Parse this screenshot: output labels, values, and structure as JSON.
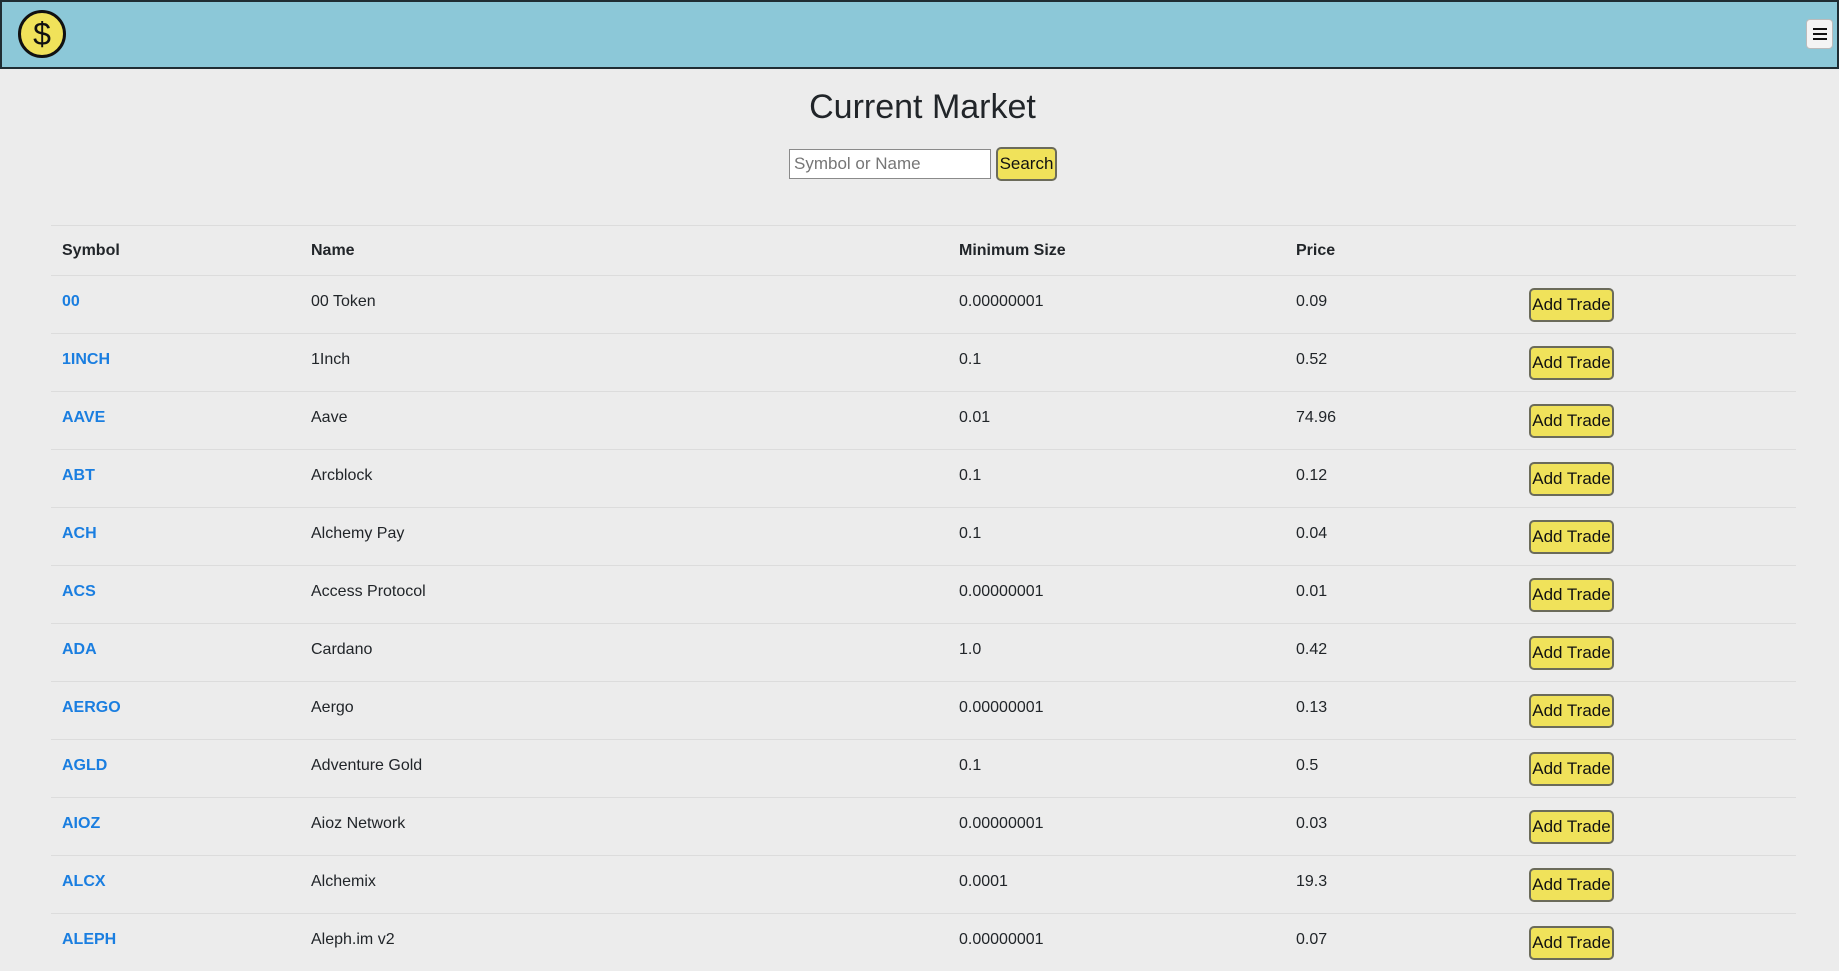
{
  "navbar": {
    "logo_icon": "dollar-coin-icon",
    "menu_icon": "hamburger-menu-icon",
    "brand_color": "#8cc8d8",
    "accent_color": "#f0e25a"
  },
  "page": {
    "title": "Current Market"
  },
  "search": {
    "placeholder": "Symbol or Name",
    "value": "",
    "button_label": "Search"
  },
  "table": {
    "headers": {
      "symbol": "Symbol",
      "name": "Name",
      "min_size": "Minimum Size",
      "price": "Price"
    },
    "action_label": "Add Trade",
    "rows": [
      {
        "symbol": "00",
        "name": "00 Token",
        "min_size": "0.00000001",
        "price": "0.09"
      },
      {
        "symbol": "1INCH",
        "name": "1Inch",
        "min_size": "0.1",
        "price": "0.52"
      },
      {
        "symbol": "AAVE",
        "name": "Aave",
        "min_size": "0.01",
        "price": "74.96"
      },
      {
        "symbol": "ABT",
        "name": "Arcblock",
        "min_size": "0.1",
        "price": "0.12"
      },
      {
        "symbol": "ACH",
        "name": "Alchemy Pay",
        "min_size": "0.1",
        "price": "0.04"
      },
      {
        "symbol": "ACS",
        "name": "Access Protocol",
        "min_size": "0.00000001",
        "price": "0.01"
      },
      {
        "symbol": "ADA",
        "name": "Cardano",
        "min_size": "1.0",
        "price": "0.42"
      },
      {
        "symbol": "AERGO",
        "name": "Aergo",
        "min_size": "0.00000001",
        "price": "0.13"
      },
      {
        "symbol": "AGLD",
        "name": "Adventure Gold",
        "min_size": "0.1",
        "price": "0.5"
      },
      {
        "symbol": "AIOZ",
        "name": "Aioz Network",
        "min_size": "0.00000001",
        "price": "0.03"
      },
      {
        "symbol": "ALCX",
        "name": "Alchemix",
        "min_size": "0.0001",
        "price": "19.3"
      },
      {
        "symbol": "ALEPH",
        "name": "Aleph.im v2",
        "min_size": "0.00000001",
        "price": "0.07"
      }
    ]
  }
}
